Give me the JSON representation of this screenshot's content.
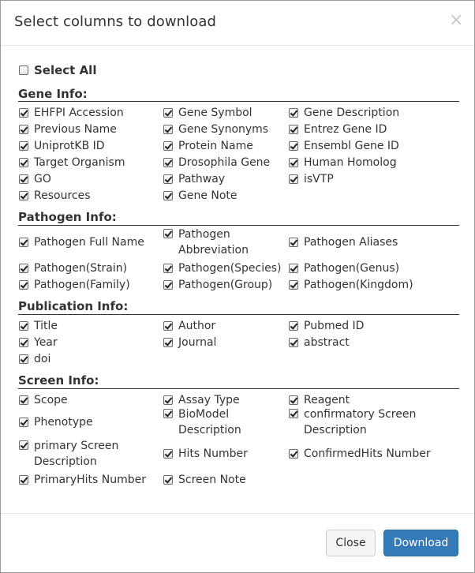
{
  "dialog": {
    "title": "Select columns to download",
    "close_glyph": "×"
  },
  "select_all": {
    "label": "Select All",
    "checked": false
  },
  "sections": [
    {
      "title": "Gene Info:",
      "items": [
        {
          "label": "EHFPI Accession",
          "checked": true
        },
        {
          "label": "Gene Symbol",
          "checked": true
        },
        {
          "label": "Gene Description",
          "checked": true
        },
        {
          "label": "Previous Name",
          "checked": true
        },
        {
          "label": "Gene Synonyms",
          "checked": true
        },
        {
          "label": "Entrez Gene ID",
          "checked": true
        },
        {
          "label": "UniprotKB ID",
          "checked": true
        },
        {
          "label": "Protein Name",
          "checked": true
        },
        {
          "label": "Ensembl Gene ID",
          "checked": true
        },
        {
          "label": "Target Organism",
          "checked": true
        },
        {
          "label": "Drosophila Gene",
          "checked": true
        },
        {
          "label": "Human Homolog",
          "checked": true
        },
        {
          "label": "GO",
          "checked": true
        },
        {
          "label": "Pathway",
          "checked": true
        },
        {
          "label": "isVTP",
          "checked": true
        },
        {
          "label": "Resources",
          "checked": true
        },
        {
          "label": "Gene Note",
          "checked": true
        }
      ]
    },
    {
      "title": "Pathogen Info:",
      "items": [
        {
          "label": "Pathogen Full Name",
          "checked": true
        },
        {
          "label": "Pathogen Abbreviation",
          "checked": true
        },
        {
          "label": "Pathogen Aliases",
          "checked": true
        },
        {
          "label": "Pathogen(Strain)",
          "checked": true
        },
        {
          "label": "Pathogen(Species)",
          "checked": true
        },
        {
          "label": "Pathogen(Genus)",
          "checked": true
        },
        {
          "label": "Pathogen(Family)",
          "checked": true
        },
        {
          "label": "Pathogen(Group)",
          "checked": true
        },
        {
          "label": "Pathogen(Kingdom)",
          "checked": true
        }
      ]
    },
    {
      "title": "Publication Info:",
      "items": [
        {
          "label": "Title",
          "checked": true
        },
        {
          "label": "Author",
          "checked": true
        },
        {
          "label": "Pubmed ID",
          "checked": true
        },
        {
          "label": "Year",
          "checked": true
        },
        {
          "label": "Journal",
          "checked": true
        },
        {
          "label": "abstract",
          "checked": true
        },
        {
          "label": "doi",
          "checked": true
        }
      ]
    },
    {
      "title": "Screen Info:",
      "items": [
        {
          "label": "Scope",
          "checked": true
        },
        {
          "label": "Assay Type",
          "checked": true
        },
        {
          "label": "Reagent",
          "checked": true
        },
        {
          "label": "Phenotype",
          "checked": true
        },
        {
          "label": "BioModel Description",
          "checked": true
        },
        {
          "label": "confirmatory Screen Description",
          "checked": true
        },
        {
          "label": "primary Screen Description",
          "checked": true
        },
        {
          "label": "Hits Number",
          "checked": true
        },
        {
          "label": "ConfirmedHits Number",
          "checked": true
        },
        {
          "label": "PrimaryHits Number",
          "checked": true
        },
        {
          "label": "Screen Note",
          "checked": true
        }
      ]
    }
  ],
  "footer": {
    "close_label": "Close",
    "download_label": "Download"
  },
  "colors": {
    "primary_button": "#337ab7",
    "default_button": "#f5f5f5",
    "section_rule": "#333333"
  }
}
